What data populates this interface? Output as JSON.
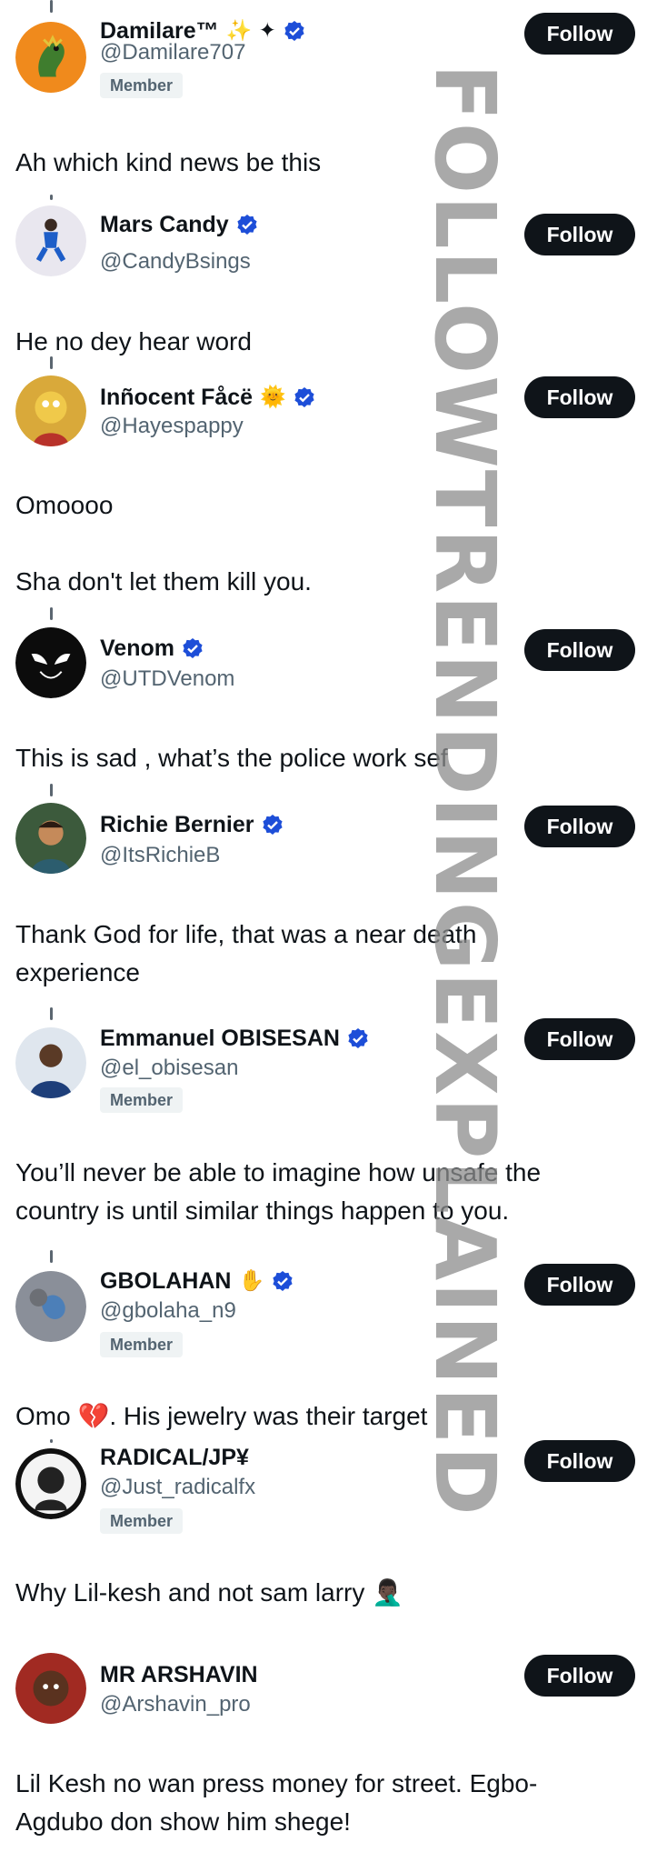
{
  "posts": [
    {
      "name": "Damilare™",
      "name_emoji": "✨ ✦",
      "handle": "@Damilare707",
      "badge": "Member",
      "follow": "Follow",
      "text": "Ah which kind news be this"
    },
    {
      "name": "Mars Candy",
      "name_emoji": "",
      "handle": "@CandyBsings",
      "badge": "",
      "follow": "Follow",
      "text": "He no dey hear word"
    },
    {
      "name": "Inñocent Fåcë",
      "name_emoji": "🌞",
      "handle": "@Hayespappy",
      "badge": "",
      "follow": "Follow",
      "text": "Omoooo",
      "text2": "Sha don't let them kill you."
    },
    {
      "name": "Venom",
      "name_emoji": "",
      "handle": "@UTDVenom",
      "badge": "",
      "follow": "Follow",
      "text": "This is sad , what’s the police work sef"
    },
    {
      "name": "Richie Bernier",
      "name_emoji": "",
      "handle": "@ItsRichieB",
      "badge": "",
      "follow": "Follow",
      "text": "Thank God for life, that was a near death experience"
    },
    {
      "name": "Emmanuel OBISESAN",
      "name_emoji": "",
      "handle": "@el_obisesan",
      "badge": "Member",
      "follow": "Follow",
      "text": "You’ll never be able to imagine how unsafe the country is until similar things happen to you."
    },
    {
      "name": "GBOLAHAN",
      "name_emoji": "✋",
      "handle": "@gbolaha_n9",
      "badge": "Member",
      "follow": "Follow",
      "text": "Omo 💔. His jewelry was their target"
    },
    {
      "name": "RADICAL/JP¥",
      "name_emoji": "",
      "handle": "@Just_radicalfx",
      "badge": "Member",
      "follow": "Follow",
      "text": "Why Lil-kesh and not sam larry 🤦🏿‍♂️"
    },
    {
      "name": "MR ARSHAVIN",
      "name_emoji": "",
      "handle": "@Arshavin_pro",
      "badge": "",
      "follow": "Follow",
      "text": "Lil Kesh no wan press money for street. Egbo-Agdubo don show him shege!"
    }
  ],
  "watermark": "FOLLOWTRENDINGEXPLAINED",
  "colors": {
    "text": "#0f1419",
    "secondary": "#536471",
    "verified": "#1d4ed8",
    "button": "#0f1419"
  }
}
